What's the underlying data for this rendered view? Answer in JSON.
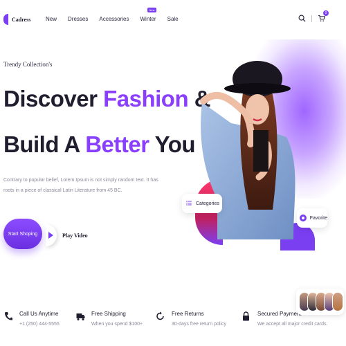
{
  "header": {
    "logo_text": "Cadress",
    "nav": [
      {
        "label": "New"
      },
      {
        "label": "Dresses"
      },
      {
        "label": "Accessories"
      },
      {
        "label": "Winter",
        "badge": "New"
      },
      {
        "label": "Sale"
      }
    ],
    "cart_count": "0"
  },
  "hero": {
    "eyebrow": "Trendy Collection's",
    "line1_a": "Discover ",
    "line1_b": "Fashion",
    "line1_c": " &",
    "line2_a": "Build A ",
    "line2_b": "Better",
    "line2_c": " You",
    "description": "Contrary to popular belief, Lorem Ipsum is not simply random text. It has roots in a piece of classical Latin Literature from 45 BC.",
    "cta_label": "Start Shoping",
    "play_label": "Play Video",
    "chip_categories": "Categories",
    "chip_favorite": "Favorite"
  },
  "features": [
    {
      "title": "Call Us Anytime",
      "subtitle": "+1 (250) 444-5555",
      "icon": "phone-icon"
    },
    {
      "title": "Free Shipping",
      "subtitle": "When you spend $100+",
      "icon": "truck-icon"
    },
    {
      "title": "Free Returns",
      "subtitle": "30-days free return policy",
      "icon": "return-icon"
    },
    {
      "title": "Secured Payment",
      "subtitle": "We accept all major credit cards.",
      "icon": "lock-icon"
    }
  ],
  "colors": {
    "accent": "#8a3ffc",
    "text": "#1f1d2e",
    "muted": "#8a8898",
    "pink": "#ff3a6b"
  }
}
